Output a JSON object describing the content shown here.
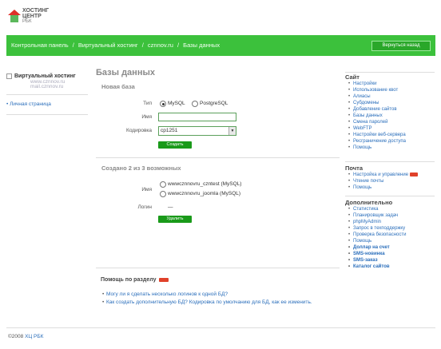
{
  "logo": {
    "line1": "ХОСТИНГ",
    "line2": "ЦЕНТР",
    "line3": "РБК"
  },
  "breadcrumb": [
    "Контрольная панель",
    "/",
    "Виртуальный хостинг",
    "/",
    "cznnov.ru",
    "/",
    "Базы данных"
  ],
  "header": {
    "back_button": "Вернуться назад"
  },
  "left": {
    "section_title": "Виртуальный хостинг",
    "ghost1": "www.cznnov.ru",
    "ghost2": "mail.cznnov.ru",
    "personal_link": "Личная страница"
  },
  "main": {
    "title": "Базы данных",
    "new_db": "Новая база",
    "type_label": "Тип",
    "type_mysql": "MySQL",
    "type_postgres": "PostgreSQL",
    "name_label": "Имя",
    "name_value": "",
    "encoding_label": "Кодировка",
    "encoding_value": "cp1251",
    "create_button": "Создать",
    "created_title": "Создано 2 из 3 возможных",
    "db_label": "Имя",
    "db1": "wwwcznnovru_czntest (MySQL)",
    "db2": "wwwcznnovru_joomla (MySQL)",
    "login_label": "Логин",
    "login_value": "—",
    "delete_button": "Удалить",
    "help_title": "Помощь по разделу",
    "help1": "Могу ли я сделать несколько логинов к одной БД?",
    "help2": "Как создать дополнительную БД? Кодировка по умолчанию для БД, как ее изменить."
  },
  "right": {
    "site_title": "Сайт",
    "site_items": [
      "Настройки",
      "Использование квот",
      "Алиасы",
      "Субдомены",
      "Добавление сайтов",
      "Базы данных",
      "Смена паролей",
      "WebFTP",
      "Настройки веб-сервера",
      "Ресграничение доступа",
      "Помощь"
    ],
    "mail_title": "Почта",
    "mail_items": [
      "Настройка и управление",
      "Чтение почты",
      "Помощь"
    ],
    "extra_title": "Дополнительно",
    "extra_items": [
      "Статистика",
      "Планировщик задач",
      "phpMyAdmin",
      "Запрос в техподдержку",
      "Проверка безопасности",
      "Помощь"
    ],
    "bold_items": [
      "Доллар на счет",
      "SMS-новинка",
      "SMS-заказ",
      "Каталог сайтов"
    ]
  },
  "footer": {
    "copyright": "©2008",
    "link": "ХЦ РБК"
  }
}
